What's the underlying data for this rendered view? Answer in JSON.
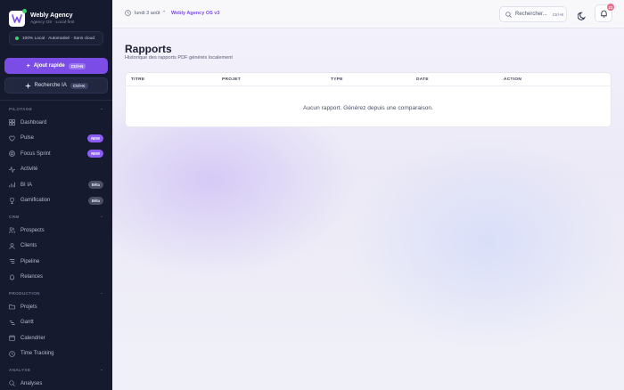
{
  "brand": {
    "name": "Webly Agency",
    "subtitle": "Agency OS · Local-first"
  },
  "status": {
    "text": "100% Local · Automatisé · Sans cloud"
  },
  "actions": {
    "quick_add": {
      "label": "Ajout rapide",
      "shortcut": "Ctrl+N"
    },
    "ai_search": {
      "label": "Recherche IA",
      "shortcut": "Ctrl+K"
    }
  },
  "sidebar": {
    "sections": [
      {
        "title": "PILOTAGE",
        "items": [
          {
            "label": "Dashboard",
            "icon": "grid-icon"
          },
          {
            "label": "Pulse",
            "icon": "pulse-icon",
            "badge": "NEW"
          },
          {
            "label": "Focus Sprint",
            "icon": "target-icon",
            "badge": "NEW"
          },
          {
            "label": "Activité",
            "icon": "activity-icon"
          },
          {
            "label": "BI IA",
            "icon": "chart-icon",
            "badge": "Bêta"
          },
          {
            "label": "Gamification",
            "icon": "trophy-icon",
            "badge": "Bêta"
          }
        ]
      },
      {
        "title": "CRM",
        "items": [
          {
            "label": "Prospects",
            "icon": "users-icon"
          },
          {
            "label": "Clients",
            "icon": "user-icon"
          },
          {
            "label": "Pipeline",
            "icon": "pipeline-icon"
          },
          {
            "label": "Relances",
            "icon": "bell-icon"
          }
        ]
      },
      {
        "title": "PRODUCTION",
        "items": [
          {
            "label": "Projets",
            "icon": "folder-icon"
          },
          {
            "label": "Gantt",
            "icon": "gantt-icon"
          },
          {
            "label": "Calendrier",
            "icon": "calendar-icon"
          },
          {
            "label": "Time Tracking",
            "icon": "clock-icon"
          }
        ]
      },
      {
        "title": "ANALYSE",
        "items": [
          {
            "label": "Analyses",
            "icon": "search-icon"
          }
        ]
      }
    ]
  },
  "topbar": {
    "date": "lundi 3 août",
    "app_name": "Webly Agency OS v3",
    "search_label": "Rechercher...",
    "search_shortcut": "Ctrl+K",
    "notification_count": "21"
  },
  "page": {
    "title": "Rapports",
    "subtitle": "Historique des rapports PDF générés localement",
    "columns": [
      "TITRE",
      "PROJET",
      "TYPE",
      "DATE",
      "ACTION"
    ],
    "empty_message": "Aucun rapport. Générez depuis une comparaison."
  },
  "colors": {
    "accent": "#7c4de6",
    "sidebar_bg": "#161a2e",
    "status_green": "#3ccf6e",
    "notification": "#f06a8a"
  }
}
